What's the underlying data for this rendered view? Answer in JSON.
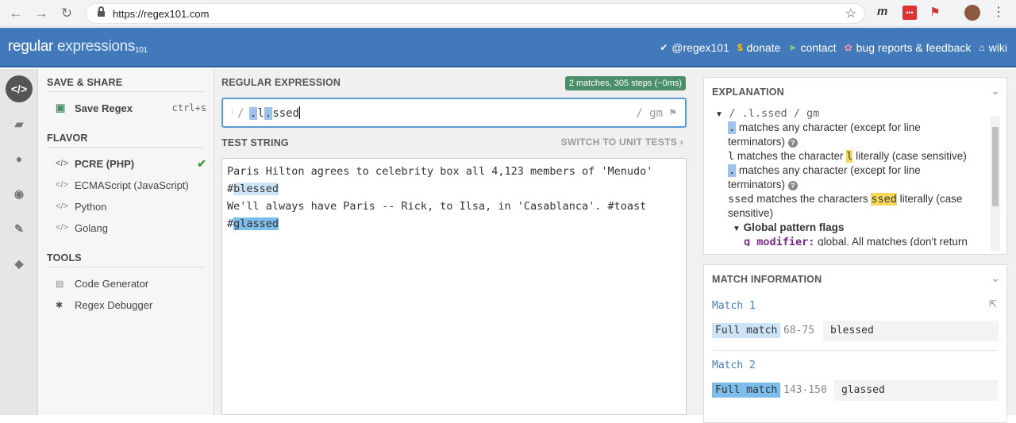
{
  "browser": {
    "url": "https://regex101.com"
  },
  "header": {
    "logo_main": "regular",
    "logo_light": "expressions",
    "logo_sup": "101",
    "links": [
      {
        "label": "@regex101",
        "icon": "twitter-icon"
      },
      {
        "label": "donate",
        "icon": "dollar-icon"
      },
      {
        "label": "contact",
        "icon": "send-icon"
      },
      {
        "label": "bug reports & feedback",
        "icon": "bug-icon"
      },
      {
        "label": "wiki",
        "icon": "library-icon"
      }
    ]
  },
  "side": {
    "save_share": "SAVE & SHARE",
    "save_regex": "Save Regex",
    "save_shortcut": "ctrl+s",
    "flavor_title": "FLAVOR",
    "flavors": [
      "PCRE (PHP)",
      "ECMAScript (JavaScript)",
      "Python",
      "Golang"
    ],
    "tools_title": "TOOLS",
    "tools": [
      "Code Generator",
      "Regex Debugger"
    ]
  },
  "regex": {
    "title": "REGULAR EXPRESSION",
    "badge": "2 matches, 305 steps (~0ms)",
    "open_slash": "/",
    "pattern_parts": [
      ".",
      "l",
      ".",
      "ssed"
    ],
    "flags": "/ gm"
  },
  "test": {
    "title": "TEST STRING",
    "unit_link": "SWITCH TO UNIT TESTS",
    "line1": "Paris Hilton agrees to celebrity box all 4,123 members of 'Menudo'",
    "line2_prefix": "#",
    "line2_match": "blessed",
    "line3": "We'll always have Paris -- Rick, to Ilsa, in 'Casablanca'. #toast",
    "line4_prefix": "#",
    "line4_match": "glassed"
  },
  "explanation": {
    "title": "EXPLANATION",
    "root": "/ .l.ssed / gm",
    "r1_token": ".",
    "r1_text": "matches any character (except for line",
    "r1b_text": "terminators)",
    "r2_token": "l",
    "r2_text": "matches the character",
    "r2_lit": "l",
    "r2_tail": "literally (case sensitive)",
    "r3_token": ".",
    "r3_text": "matches any character (except for line",
    "r3b_text": "terminators)",
    "r4_token": "ssed",
    "r4_text": "matches the characters",
    "r4_lit": "ssed",
    "r4_tail": "literally (case",
    "r4b_text": "sensitive)",
    "flags_title": "Global pattern flags",
    "g_mod": "g modifier:",
    "g_text": "global. All matches (don't return"
  },
  "match_info": {
    "title": "MATCH INFORMATION",
    "matches": [
      {
        "label": "Match 1",
        "kind": "Full match",
        "range": "68-75",
        "value": "blessed"
      },
      {
        "label": "Match 2",
        "kind": "Full match",
        "range": "143-150",
        "value": "glassed"
      }
    ]
  },
  "colors": {
    "header": "#4179bb",
    "match1": "#cde4f7",
    "match2": "#7cbdeb",
    "badge": "#4a8f6a",
    "check": "#3c9a3c"
  }
}
